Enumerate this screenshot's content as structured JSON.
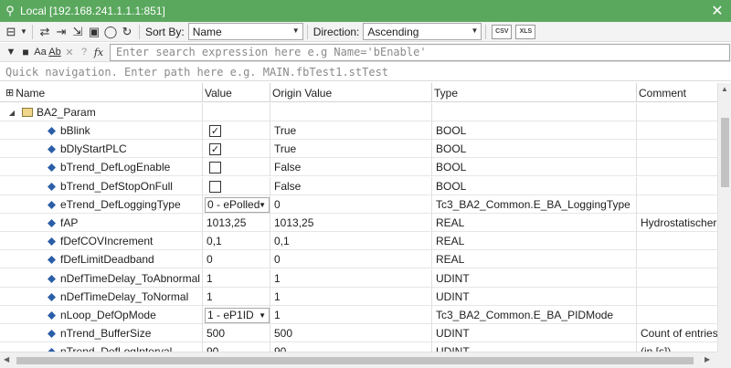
{
  "window": {
    "title": "Local [192.168.241.1.1.1:851]"
  },
  "toolbar": {
    "sort_label": "Sort By:",
    "sort_value": "Name",
    "direction_label": "Direction:",
    "direction_value": "Ascending",
    "csv_label": "CSV",
    "xls_label": "XLS"
  },
  "search": {
    "placeholder": "Enter search expression here e.g Name='bEnable'"
  },
  "navigation": {
    "placeholder": "Quick navigation. Enter path here e.g. MAIN.fbTest1.stTest"
  },
  "columns": [
    "Name",
    "Value",
    "Origin Value",
    "Type",
    "Comment"
  ],
  "tree": {
    "root": {
      "name": "BA2_Param"
    },
    "rows": [
      {
        "name": "bBlink",
        "value_kind": "checkbox",
        "checked": true,
        "value": "",
        "origin": "True",
        "type": "BOOL",
        "comment": ""
      },
      {
        "name": "bDlyStartPLC",
        "value_kind": "checkbox",
        "checked": true,
        "value": "",
        "origin": "True",
        "type": "BOOL",
        "comment": ""
      },
      {
        "name": "bTrend_DefLogEnable",
        "value_kind": "checkbox",
        "checked": false,
        "value": "",
        "origin": "False",
        "type": "BOOL",
        "comment": ""
      },
      {
        "name": "bTrend_DefStopOnFull",
        "value_kind": "checkbox",
        "checked": false,
        "value": "",
        "origin": "False",
        "type": "BOOL",
        "comment": ""
      },
      {
        "name": "eTrend_DefLoggingType",
        "value_kind": "dropdown",
        "value": "0 - ePolled",
        "origin": "0",
        "type": "Tc3_BA2_Common.E_BA_LoggingType",
        "comment": ""
      },
      {
        "name": "fAP",
        "value_kind": "text",
        "value": "1013,25",
        "origin": "1013,25",
        "type": "REAL",
        "comment": "Hydrostatischer L"
      },
      {
        "name": "fDefCOVIncrement",
        "value_kind": "text",
        "value": "0,1",
        "origin": "0,1",
        "type": "REAL",
        "comment": ""
      },
      {
        "name": "fDefLimitDeadband",
        "value_kind": "text",
        "value": "0",
        "origin": "0",
        "type": "REAL",
        "comment": ""
      },
      {
        "name": "nDefTimeDelay_ToAbnormal",
        "value_kind": "text",
        "value": "1",
        "origin": "1",
        "type": "UDINT",
        "comment": ""
      },
      {
        "name": "nDefTimeDelay_ToNormal",
        "value_kind": "text",
        "value": "1",
        "origin": "1",
        "type": "UDINT",
        "comment": ""
      },
      {
        "name": "nLoop_DefOpMode",
        "value_kind": "dropdown",
        "value": "1 - eP1ID",
        "origin": "1",
        "type": "Tc3_BA2_Common.E_BA_PIDMode",
        "comment": ""
      },
      {
        "name": "nTrend_BufferSize",
        "value_kind": "text",
        "value": "500",
        "origin": "500",
        "type": "UDINT",
        "comment": "Count of entries i"
      },
      {
        "name": "nTrend_DefLogInterval",
        "value_kind": "text",
        "value": "90",
        "origin": "90",
        "type": "UDINT",
        "comment": "(in [s])"
      }
    ]
  },
  "colors": {
    "titlebar": "#5aa85e",
    "var_icon": "#2b5ea8"
  }
}
